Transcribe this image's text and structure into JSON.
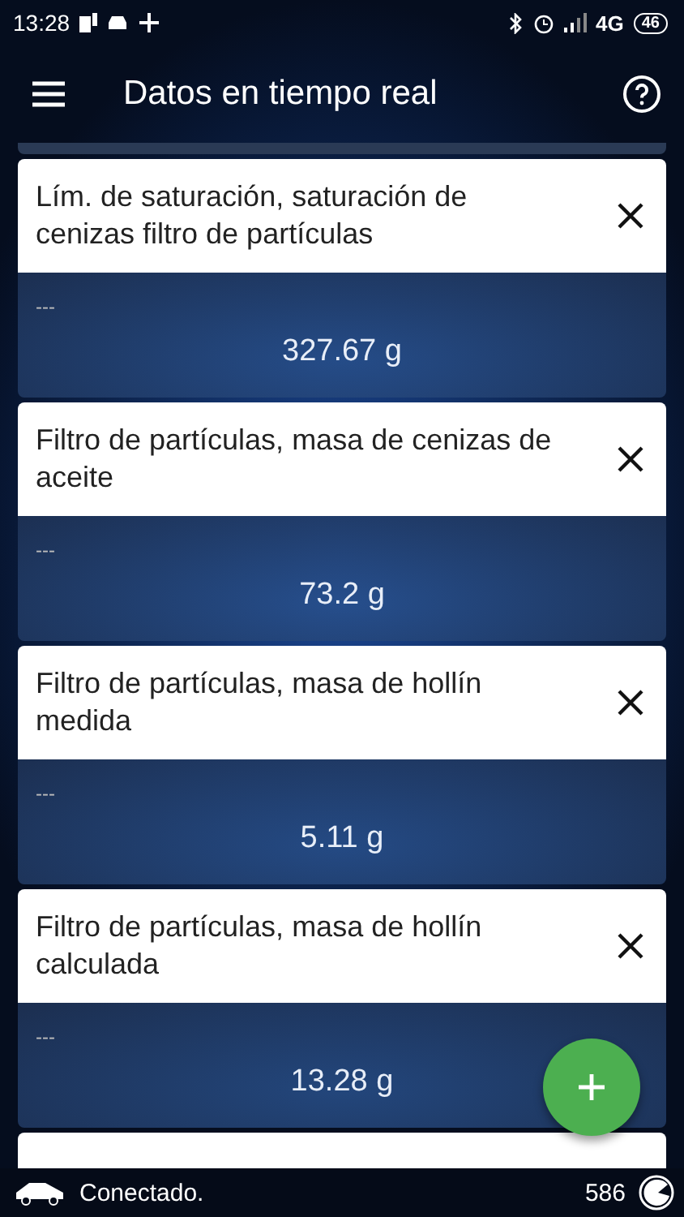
{
  "status_bar": {
    "time": "13:28",
    "network": "4G",
    "battery": "46"
  },
  "app_bar": {
    "title": "Datos en tiempo real"
  },
  "cards": [
    {
      "title": "Lím. de saturación, saturación de cenizas filtro de partículas",
      "label": "---",
      "value": "327.67 g"
    },
    {
      "title": "Filtro de partículas, masa de cenizas de aceite",
      "label": "---",
      "value": "73.2 g"
    },
    {
      "title": "Filtro de partículas, masa de hollín medida",
      "label": "---",
      "value": "5.11 g"
    },
    {
      "title": "Filtro de partículas, masa de hollín calculada",
      "label": "---",
      "value": "13.28 g"
    }
  ],
  "footer": {
    "status": "Conectado.",
    "count": "586"
  }
}
